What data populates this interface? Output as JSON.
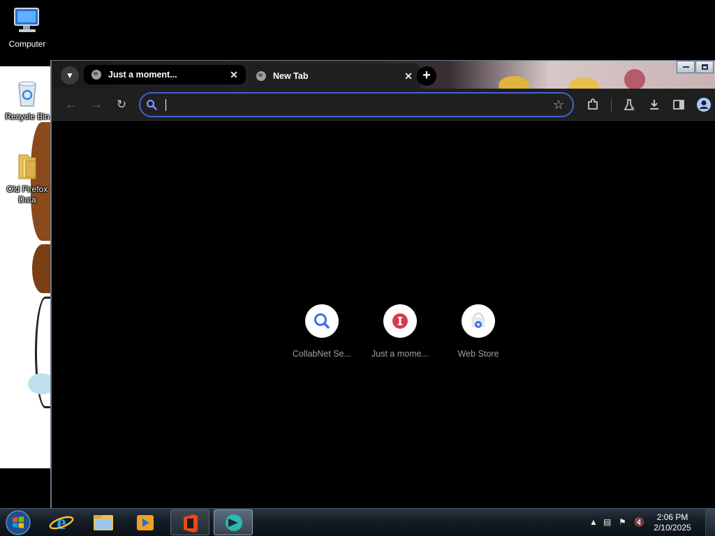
{
  "desktop": {
    "icons": [
      {
        "label": "Computer",
        "icon": "computer-icon"
      },
      {
        "label": "Recycle Bin",
        "icon": "recycle-bin-icon"
      },
      {
        "label": "Old Firefox Data",
        "icon": "folder-icon"
      }
    ]
  },
  "browser": {
    "tabs": [
      {
        "title": "Just a moment...",
        "active": false
      },
      {
        "title": "New Tab",
        "active": true
      }
    ],
    "new_tab_symbol": "+",
    "omnibox": {
      "value": "",
      "placeholder": ""
    },
    "shortcuts": [
      {
        "label": "CollabNet Se...",
        "icon": "search-icon"
      },
      {
        "label": "Just a mome...",
        "icon": "red-i-icon"
      },
      {
        "label": "Web Store",
        "icon": "web-store-icon"
      }
    ],
    "colors": {
      "accent": "#3d63d6",
      "toolbar": "#1f1f1f",
      "content_bg": "#000000"
    }
  },
  "taskbar": {
    "apps": [
      "Internet Explorer",
      "Windows Explorer",
      "Windows Media Player",
      "Microsoft Office",
      "Chromium"
    ],
    "clock": {
      "time": "2:06 PM",
      "date": "2/10/2025"
    }
  }
}
